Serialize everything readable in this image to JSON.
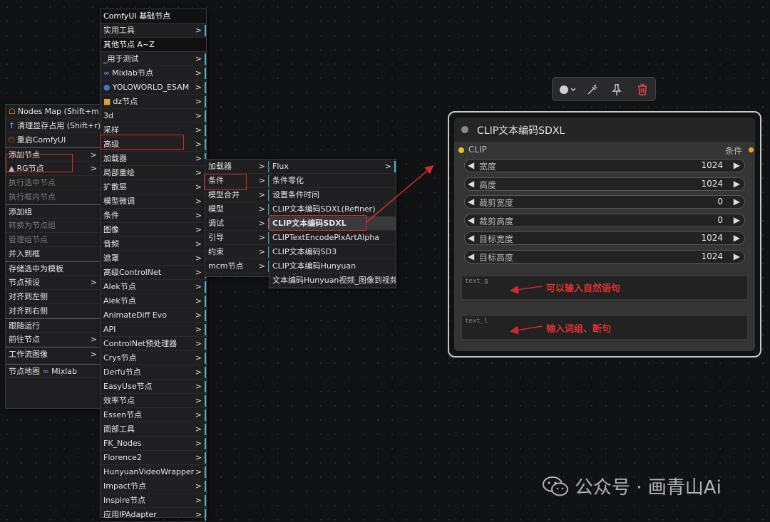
{
  "context_menu": {
    "items": [
      {
        "label": "Nodes Map (Shift+m)",
        "icon": "sitemap-icon",
        "arrow": false,
        "disabled": false
      },
      {
        "label": "清理显存占用 (Shift+r)",
        "icon": "rocket-icon",
        "arrow": false,
        "disabled": false
      },
      {
        "label": "重启ComfyUI",
        "icon": "power-icon",
        "arrow": false,
        "disabled": false
      },
      {
        "label": "添加节点",
        "arrow": true,
        "disabled": false,
        "highlighted": true
      },
      {
        "label": "RG节点",
        "icon": "shapes-icon",
        "arrow": true,
        "disabled": false
      },
      {
        "label": "执行选中节点",
        "arrow": false,
        "disabled": true
      },
      {
        "label": "执行框内节点",
        "arrow": false,
        "disabled": true
      },
      {
        "label": "添加组",
        "arrow": false,
        "disabled": false
      },
      {
        "label": "转换为节点组",
        "arrow": false,
        "disabled": true
      },
      {
        "label": "管理组节点",
        "arrow": false,
        "disabled": true
      },
      {
        "label": "并入到框",
        "arrow": false,
        "disabled": false
      },
      {
        "label": "存储选中为模板",
        "arrow": false,
        "disabled": false
      },
      {
        "label": "节点预设",
        "arrow": true,
        "disabled": false
      },
      {
        "label": "对齐到左侧",
        "arrow": false,
        "disabled": false
      },
      {
        "label": "对齐到右侧",
        "arrow": false,
        "disabled": false
      },
      {
        "label": "跟随运行",
        "arrow": false,
        "disabled": false
      },
      {
        "label": "前往节点",
        "arrow": true,
        "disabled": false
      },
      {
        "label": "工作流图像",
        "arrow": true,
        "disabled": false
      },
      {
        "label": "节点地图",
        "arrow": false,
        "disabled": false,
        "suffix": "Mixlab"
      }
    ]
  },
  "node_menu": {
    "header1": "ComfyUI 基础节点",
    "header2": "其他节点 A~Z",
    "items": [
      "实用工具",
      "_用于测试",
      "Mixlab节点",
      "YOLOWORLD_ESAM",
      "dz节点",
      "3d",
      "采样",
      "高级",
      "加载器",
      "局部重绘",
      "扩散层",
      "模型微调",
      "条件",
      "图像",
      "音频",
      "遮罩",
      "高级ControlNet",
      "Alek节点",
      "Alek节点",
      "AnimateDiff Evo",
      "API",
      "ControlNet预处理器",
      "Crys节点",
      "Derfu节点",
      "EasyUse节点",
      "效率节点",
      "Essen节点",
      "面部工具",
      "FK_Nodes",
      "Florence2",
      "HunyuanVideoWrapper",
      "Impact节点",
      "Inspire节点",
      "应用IPAdapter"
    ]
  },
  "advanced_menu": {
    "items": [
      "加载器",
      "条件",
      "模型合并",
      "模型",
      "调试",
      "引导",
      "约束",
      "mcm节点"
    ]
  },
  "conditioning_menu": {
    "items": [
      "Flux",
      "条件零化",
      "设置条件时间",
      "CLIP文本编码SDXL(Refiner)",
      "CLIP文本编码SDXL",
      "CLIPTextEncodePixArtAlpha",
      "CLIP文本编码SD3",
      "CLIP文本编码Hunyuan",
      "文本编码Hunyuan视频_图像到视频"
    ]
  },
  "toolbar": {
    "icons": [
      "color-dot-icon",
      "bypass-icon",
      "pin-icon",
      "trash-icon"
    ]
  },
  "node": {
    "title": "CLIP文本编码SDXL",
    "input": "CLIP",
    "output": "条件",
    "widgets": [
      {
        "label": "宽度",
        "value": "1024"
      },
      {
        "label": "高度",
        "value": "1024"
      },
      {
        "label": "裁剪宽度",
        "value": "0"
      },
      {
        "label": "裁剪高度",
        "value": "0"
      },
      {
        "label": "目标宽度",
        "value": "1024"
      },
      {
        "label": "目标高度",
        "value": "1024"
      }
    ],
    "text_g_placeholder": "text_g",
    "text_l_placeholder": "text_l"
  },
  "annotations": {
    "text_g": "可以输入自然语句",
    "text_l": "输入词组、断句"
  },
  "colors": {
    "highlight_box": "#d42a2a",
    "arrow": "#d42a2a",
    "node_border": "#c8c8c8",
    "input_dot": "#f0c020",
    "output_dot": "#f0a030"
  },
  "watermark": "公众号 · 画青山Ai"
}
